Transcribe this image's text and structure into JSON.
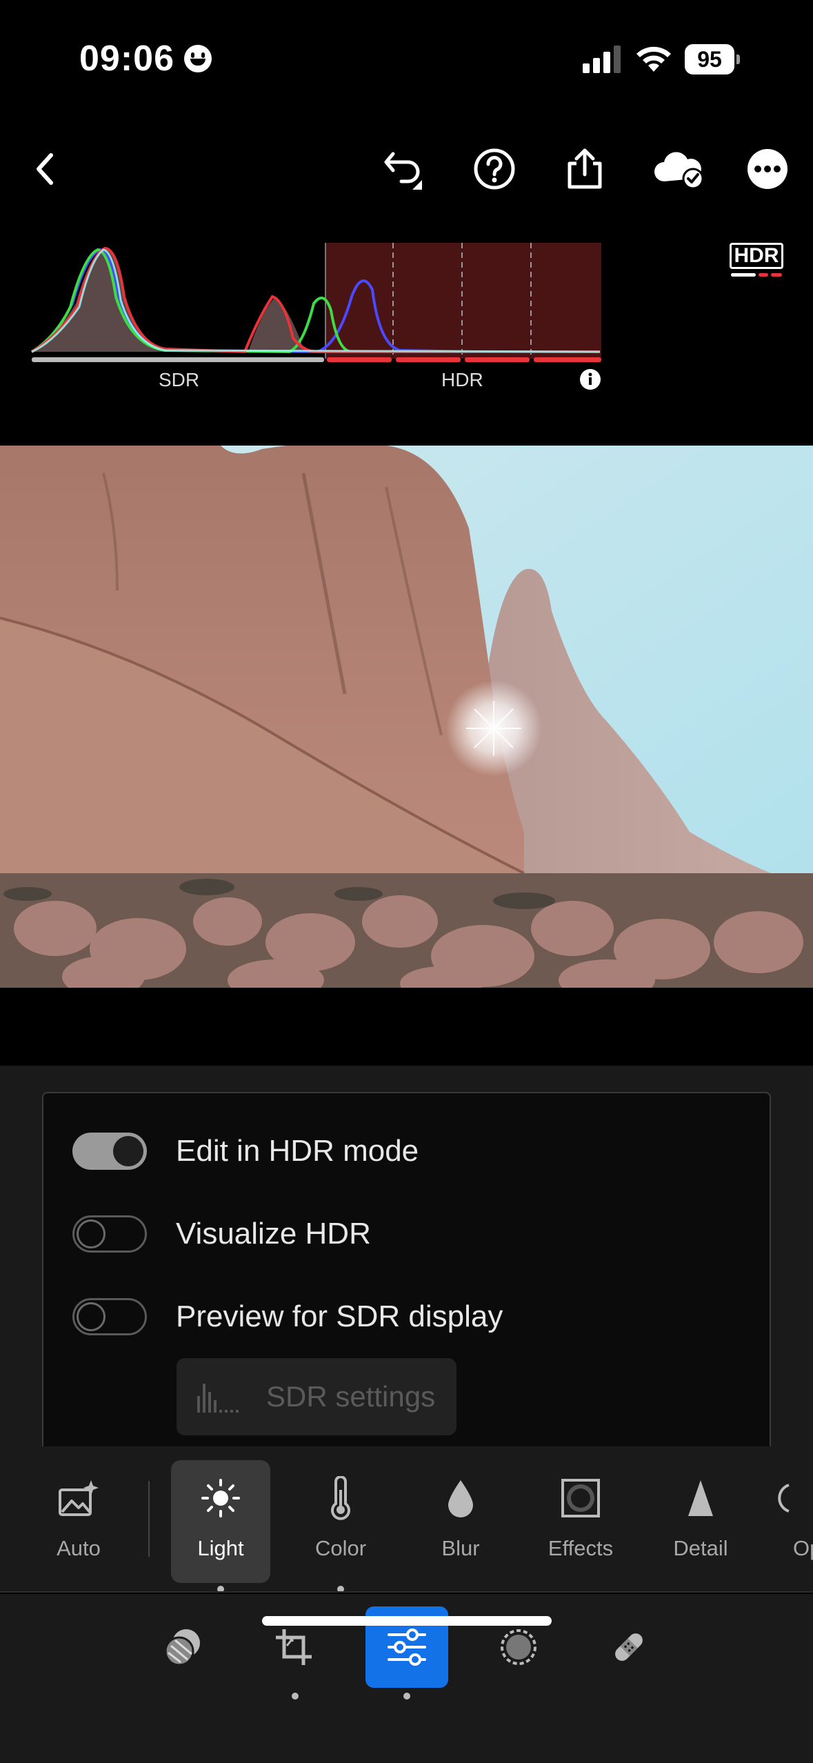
{
  "status_bar": {
    "time": "09:06",
    "battery": "95"
  },
  "toolbar": {
    "icons": [
      "back-chevron-icon",
      "undo-icon",
      "help-icon",
      "share-icon",
      "cloud-synced-icon",
      "more-icon"
    ]
  },
  "histogram": {
    "sdr_label": "SDR",
    "hdr_label": "HDR",
    "badge": "HDR",
    "colors": {
      "red": "#e8333a",
      "green": "#3ddc45",
      "blue": "#4a4aff",
      "hdr_region": "#4a1414"
    }
  },
  "hdr_panel": {
    "toggles": [
      {
        "label": "Edit in HDR mode",
        "on": true
      },
      {
        "label": "Visualize HDR",
        "on": false
      },
      {
        "label": "Preview for SDR display",
        "on": false
      }
    ],
    "sdr_settings_label": "SDR settings"
  },
  "tools": [
    {
      "label": "Auto",
      "icon": "auto-image-icon"
    },
    {
      "label": "Light",
      "icon": "sun-icon",
      "active": true
    },
    {
      "label": "Color",
      "icon": "thermometer-icon"
    },
    {
      "label": "Blur",
      "icon": "drop-icon"
    },
    {
      "label": "Effects",
      "icon": "effects-icon"
    },
    {
      "label": "Detail",
      "icon": "triangle-icon"
    },
    {
      "label": "Op",
      "icon": "optics-icon"
    }
  ],
  "bottom_nav": {
    "items": [
      "presets-icon",
      "crop-icon",
      "edit-sliders-icon",
      "masking-icon",
      "healing-icon"
    ],
    "active": "edit-sliders-icon",
    "accent": "#1472e8"
  }
}
